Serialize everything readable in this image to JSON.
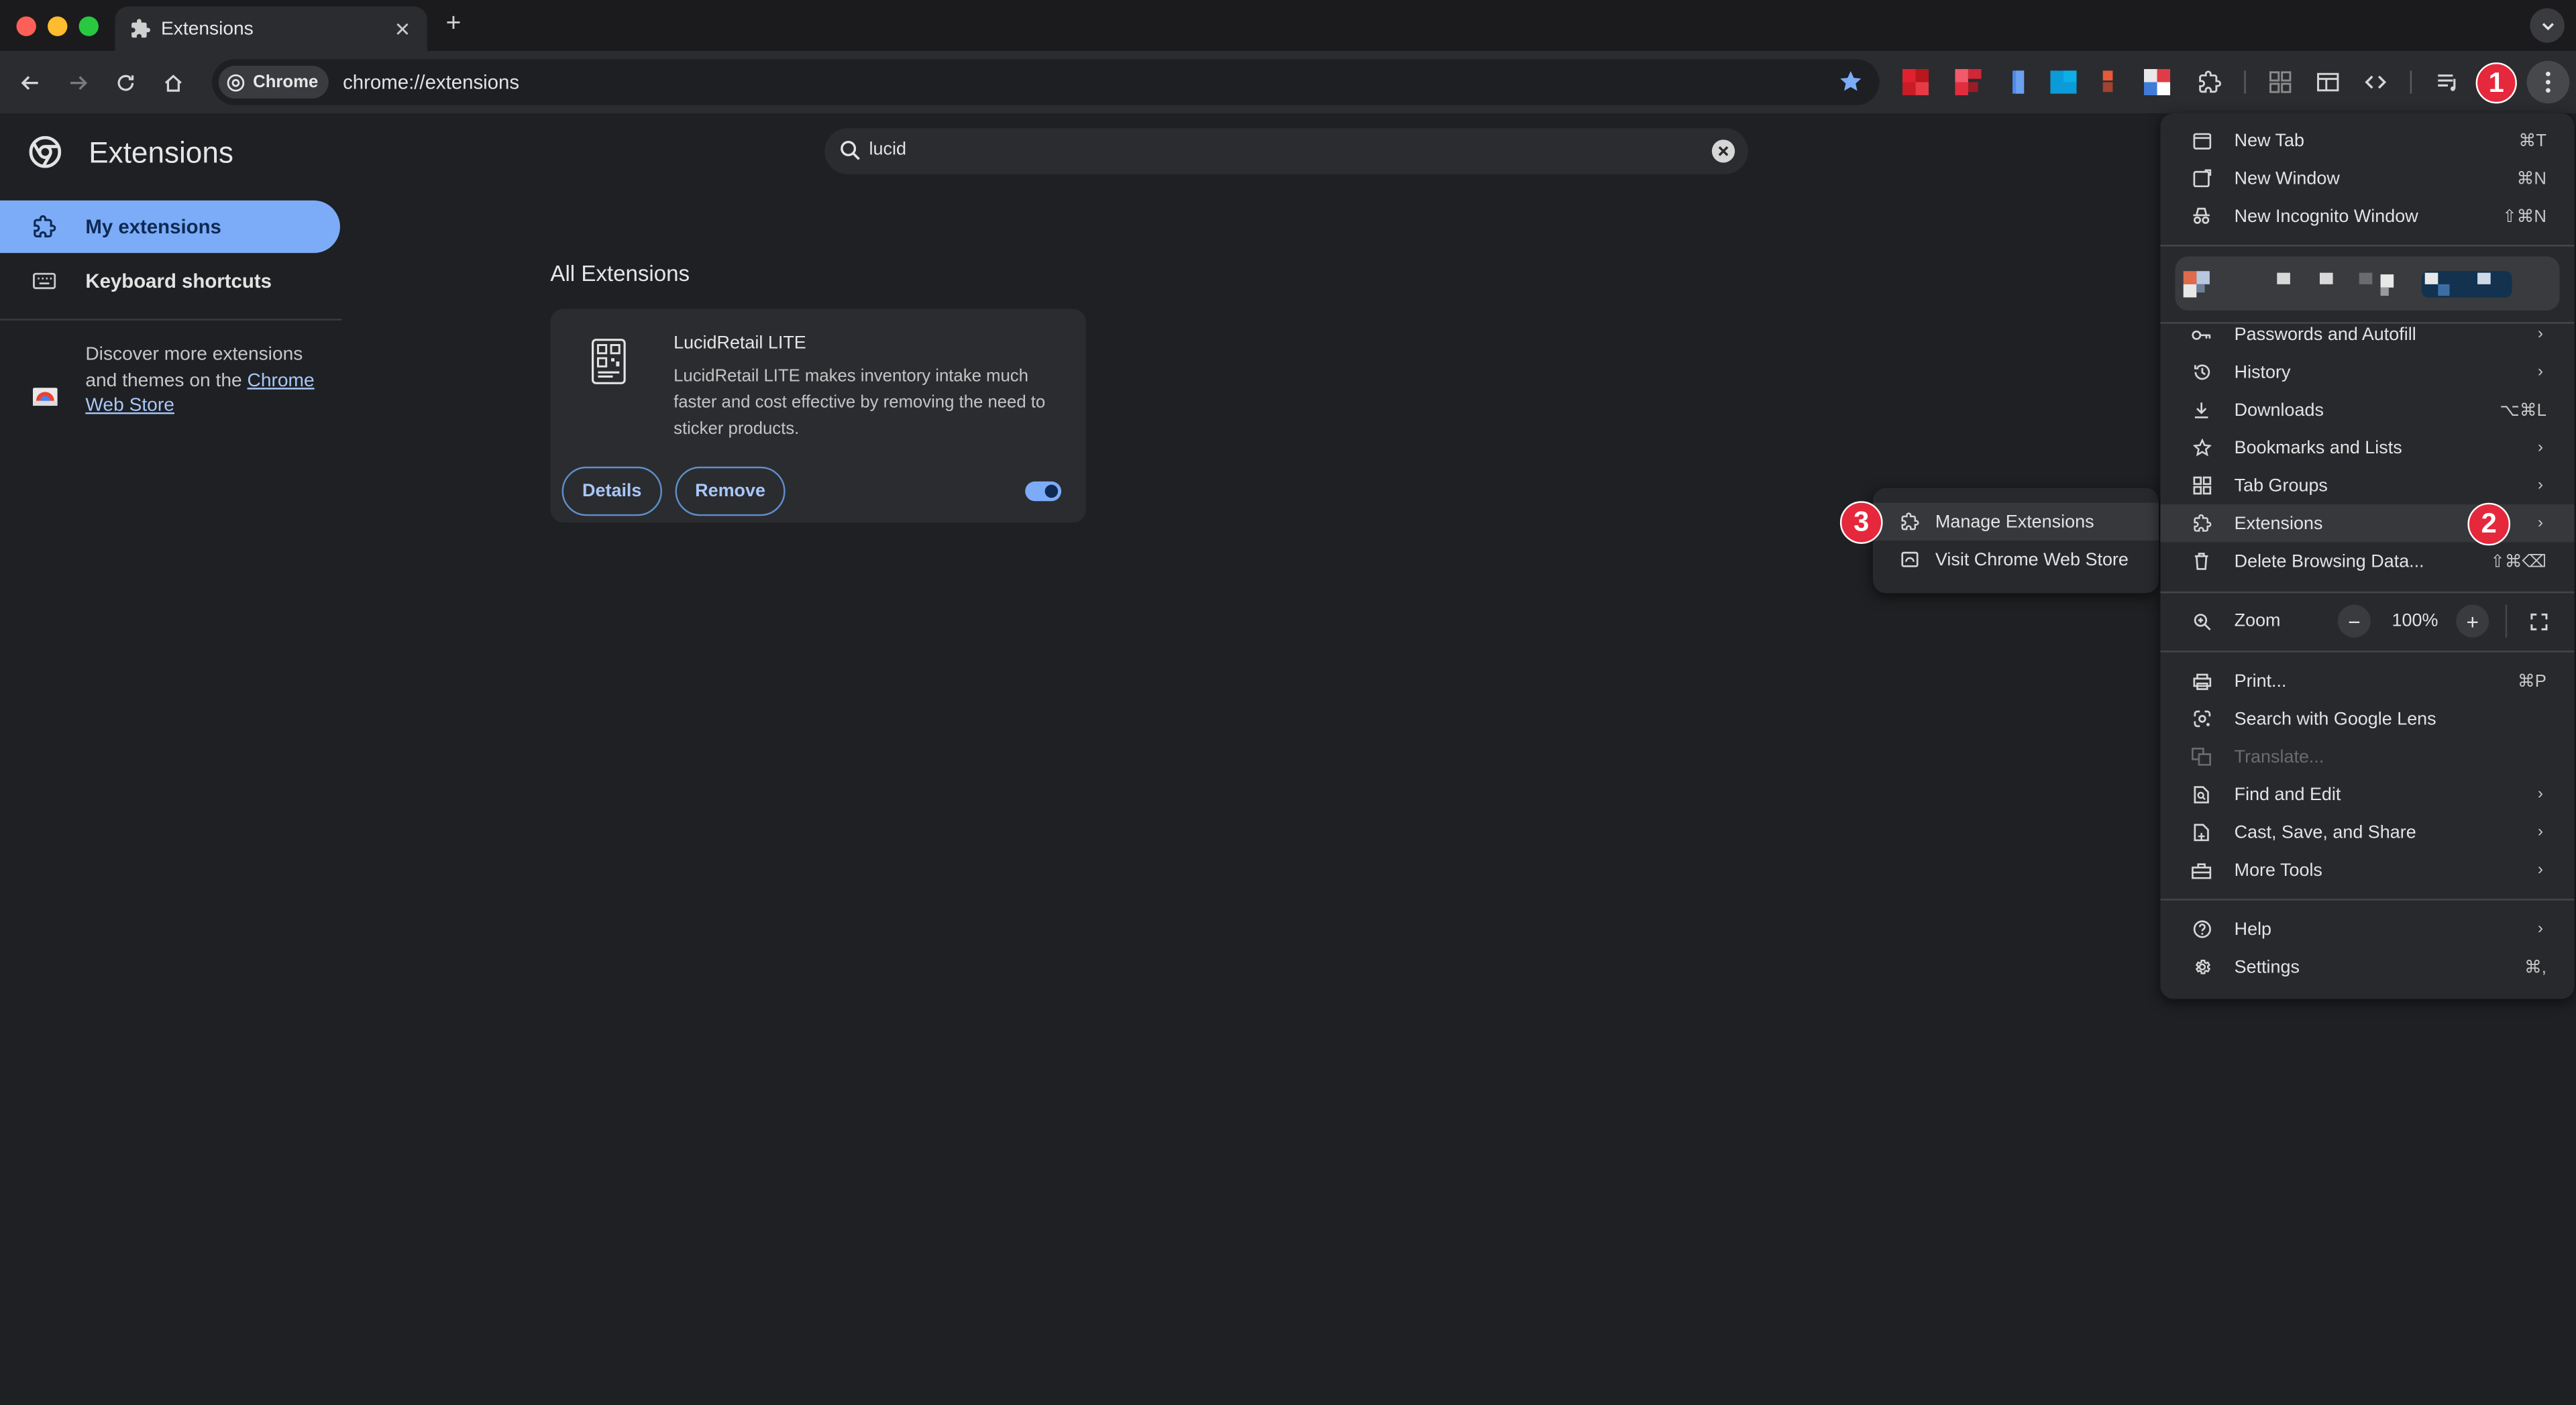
{
  "window": {
    "tab_title": "Extensions",
    "new_tab_symbol": "+"
  },
  "toolbar": {
    "chip_label": "Chrome",
    "url": "chrome://extensions"
  },
  "markers": [
    "1",
    "2",
    "3"
  ],
  "page": {
    "title": "Extensions",
    "search": {
      "value": "lucid"
    },
    "nav": {
      "my_extensions": "My extensions",
      "keyboard_shortcuts": "Keyboard shortcuts"
    },
    "discover": {
      "prefix": "Discover more extensions and themes on the ",
      "link": "Chrome Web Store"
    },
    "section_title": "All Extensions",
    "extension": {
      "name": "LucidRetail LITE",
      "description": "LucidRetail LITE makes inventory intake much faster and cost effective by removing the need to sticker products.",
      "details_label": "Details",
      "remove_label": "Remove",
      "enabled": true
    }
  },
  "menu": {
    "items": {
      "new_tab": {
        "label": "New Tab",
        "shortcut": "⌘T"
      },
      "new_window": {
        "label": "New Window",
        "shortcut": "⌘N"
      },
      "new_incognito": {
        "label": "New Incognito Window",
        "shortcut": "⇧⌘N"
      },
      "passwords": {
        "label": "Passwords and Autofill",
        "arrow": "›"
      },
      "history": {
        "label": "History",
        "arrow": "›"
      },
      "downloads": {
        "label": "Downloads",
        "shortcut": "⌥⌘L"
      },
      "bookmarks": {
        "label": "Bookmarks and Lists",
        "arrow": "›"
      },
      "tab_groups": {
        "label": "Tab Groups",
        "arrow": "›"
      },
      "extensions": {
        "label": "Extensions",
        "arrow": "›"
      },
      "delete_data": {
        "label": "Delete Browsing Data...",
        "shortcut": "⇧⌘⌫"
      },
      "zoom": {
        "label": "Zoom",
        "minus": "−",
        "value": "100%",
        "plus": "+"
      },
      "print": {
        "label": "Print...",
        "shortcut": "⌘P"
      },
      "lens": {
        "label": "Search with Google Lens"
      },
      "translate": {
        "label": "Translate..."
      },
      "find_edit": {
        "label": "Find and Edit",
        "arrow": "›"
      },
      "cast": {
        "label": "Cast, Save, and Share",
        "arrow": "›"
      },
      "more_tools": {
        "label": "More Tools",
        "arrow": "›"
      },
      "help": {
        "label": "Help",
        "arrow": "›"
      },
      "settings": {
        "label": "Settings",
        "shortcut": "⌘,"
      }
    },
    "submenu": {
      "manage": "Manage Extensions",
      "store": "Visit Chrome Web Store"
    }
  },
  "colors": {
    "accent": "#7cacf8",
    "marker": "#e5283c",
    "background": "#1f2023"
  }
}
